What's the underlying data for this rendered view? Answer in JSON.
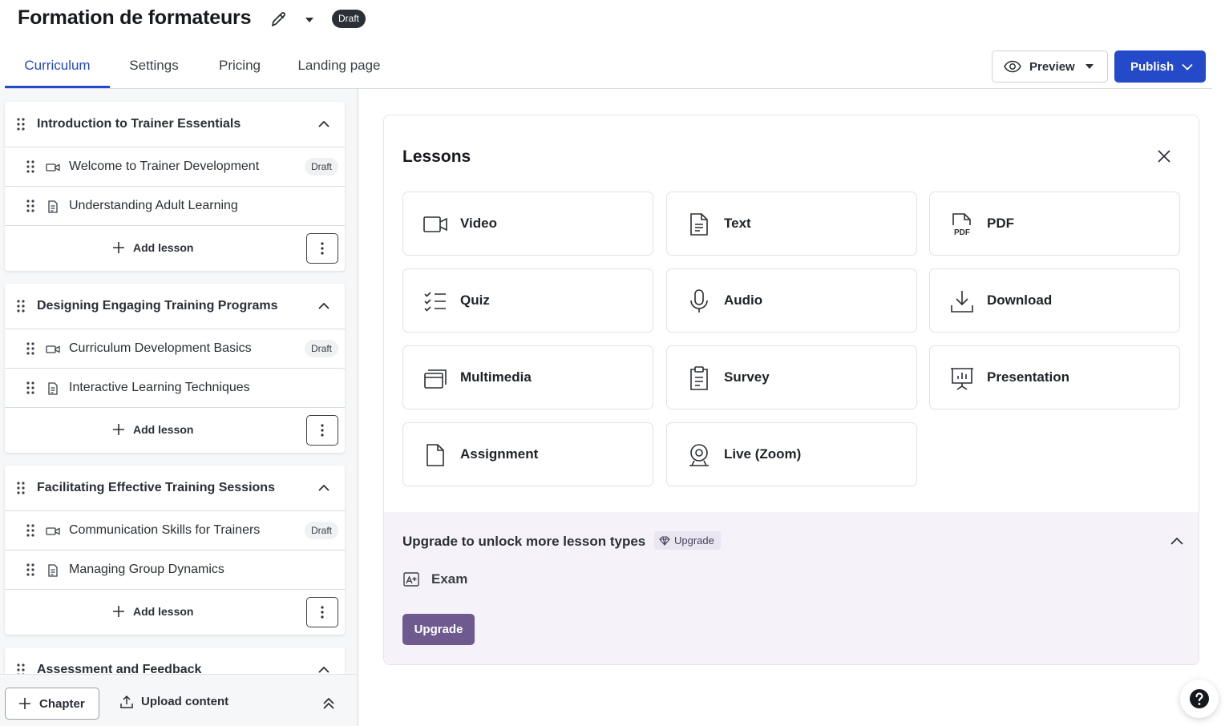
{
  "header": {
    "title": "Formation de formateurs",
    "status_badge": "Draft",
    "tabs": [
      "Curriculum",
      "Settings",
      "Pricing",
      "Landing page"
    ],
    "active_tab": "Curriculum",
    "preview_label": "Preview",
    "publish_label": "Publish",
    "accent_color": "#2449c9"
  },
  "curriculum": {
    "chapters": [
      {
        "title": "Introduction to Trainer Essentials",
        "lessons": [
          {
            "name": "Welcome to Trainer Development",
            "type": "video-icon",
            "badge": "Draft"
          },
          {
            "name": "Understanding Adult Learning",
            "type": "text-icon",
            "badge": ""
          }
        ],
        "add_lesson_label": "Add lesson"
      },
      {
        "title": "Designing Engaging Training Programs",
        "lessons": [
          {
            "name": "Curriculum Development Basics",
            "type": "video-icon",
            "badge": "Draft"
          },
          {
            "name": "Interactive Learning Techniques",
            "type": "text-icon",
            "badge": ""
          }
        ],
        "add_lesson_label": "Add lesson"
      },
      {
        "title": "Facilitating Effective Training Sessions",
        "lessons": [
          {
            "name": "Communication Skills for Trainers",
            "type": "video-icon",
            "badge": "Draft"
          },
          {
            "name": "Managing Group Dynamics",
            "type": "text-icon",
            "badge": ""
          }
        ],
        "add_lesson_label": "Add lesson"
      },
      {
        "title": "Assessment and Feedback",
        "lessons": [],
        "add_lesson_label": ""
      }
    ],
    "chapter_button_label": "Chapter",
    "upload_label": "Upload content"
  },
  "lessons_panel": {
    "title": "Lessons",
    "types": [
      {
        "label": "Video",
        "icon": "video-icon"
      },
      {
        "label": "Text",
        "icon": "text-icon"
      },
      {
        "label": "PDF",
        "icon": "pdf-icon"
      },
      {
        "label": "Quiz",
        "icon": "quiz-icon"
      },
      {
        "label": "Audio",
        "icon": "microphone-icon"
      },
      {
        "label": "Download",
        "icon": "download-icon"
      },
      {
        "label": "Multimedia",
        "icon": "multimedia-icon"
      },
      {
        "label": "Survey",
        "icon": "clipboard-icon"
      },
      {
        "label": "Presentation",
        "icon": "presentation-icon"
      },
      {
        "label": "Assignment",
        "icon": "document-icon"
      },
      {
        "label": "Live (Zoom)",
        "icon": "webcam-icon"
      }
    ],
    "upgrade": {
      "title": "Upgrade to unlock more lesson types",
      "badge": "Upgrade",
      "locked_types": [
        {
          "label": "Exam",
          "icon": "exam-icon"
        }
      ],
      "button_label": "Upgrade",
      "button_color": "#6f5a8f",
      "background_color": "#f5f3f9"
    }
  }
}
